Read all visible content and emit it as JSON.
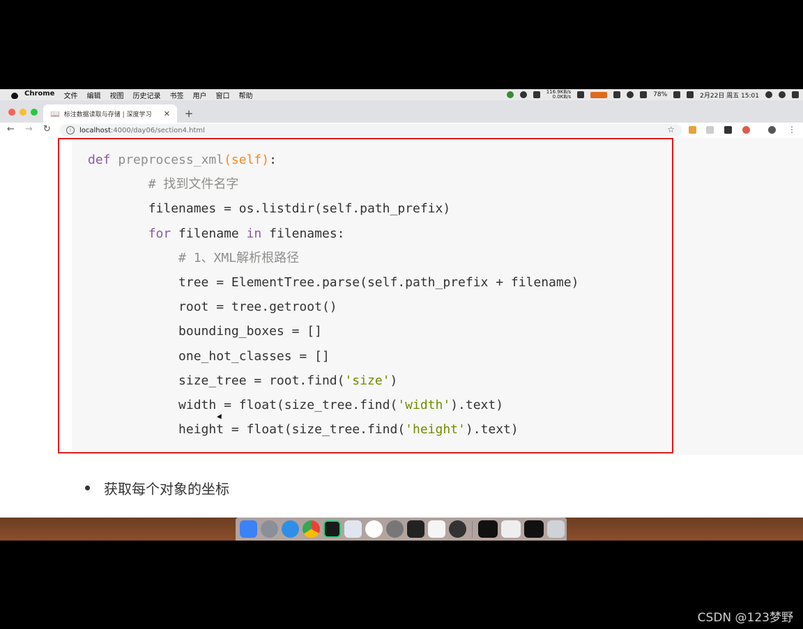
{
  "menubar": {
    "app_name": "Chrome",
    "items": [
      "文件",
      "编辑",
      "视图",
      "历史记录",
      "书签",
      "用户",
      "窗口",
      "帮助"
    ],
    "net_up": "116.9KB/s",
    "net_down": "0.0KB/s",
    "battery": "78%",
    "datetime": "2月22日 周五 15:01"
  },
  "browser": {
    "tab_title": "标注数据读取与存储 | 深度学习",
    "url_host": "localhost",
    "url_path": ":4000/day06/section4.html"
  },
  "code_lines": [
    [
      {
        "t": "def ",
        "c": "kw"
      },
      {
        "t": "preprocess_xml",
        "c": "fn"
      },
      {
        "t": "(self)",
        "c": "sf"
      },
      {
        "t": ":",
        "c": "pl"
      }
    ],
    [
      {
        "t": "        # 找到文件名字",
        "c": "cm"
      }
    ],
    [
      {
        "t": "        filenames = os.listdir(self.path_prefix)",
        "c": "pl"
      }
    ],
    [
      {
        "t": "        ",
        "c": "pl"
      },
      {
        "t": "for",
        "c": "kw"
      },
      {
        "t": " filename ",
        "c": "pl"
      },
      {
        "t": "in",
        "c": "kw"
      },
      {
        "t": " filenames:",
        "c": "pl"
      }
    ],
    [
      {
        "t": "            # 1、XML解析根路径",
        "c": "cm"
      }
    ],
    [
      {
        "t": "            tree = ElementTree.parse(self.path_prefix + filename)",
        "c": "pl"
      }
    ],
    [
      {
        "t": "            root = tree.getroot()",
        "c": "pl"
      }
    ],
    [
      {
        "t": "            bounding_boxes = []",
        "c": "pl"
      }
    ],
    [
      {
        "t": "            one_hot_classes = []",
        "c": "pl"
      }
    ],
    [
      {
        "t": "            size_tree = root.find(",
        "c": "pl"
      },
      {
        "t": "'size'",
        "c": "str"
      },
      {
        "t": ")",
        "c": "pl"
      }
    ],
    [
      {
        "t": "            width = float(size_tree.find(",
        "c": "pl"
      },
      {
        "t": "'width'",
        "c": "str"
      },
      {
        "t": ").text)",
        "c": "pl"
      }
    ],
    [
      {
        "t": "            height = float(size_tree.find(",
        "c": "pl"
      },
      {
        "t": "'height'",
        "c": "str"
      },
      {
        "t": ").text)",
        "c": "pl"
      }
    ]
  ],
  "bullet_text": "获取每个对象的坐标",
  "watermark": "CSDN @123梦野",
  "colors": {
    "highlight_border": "#e31b1b",
    "keyword": "#8959a8",
    "string": "#718c00",
    "self_param": "#f5871f",
    "comment": "#8e908c"
  }
}
